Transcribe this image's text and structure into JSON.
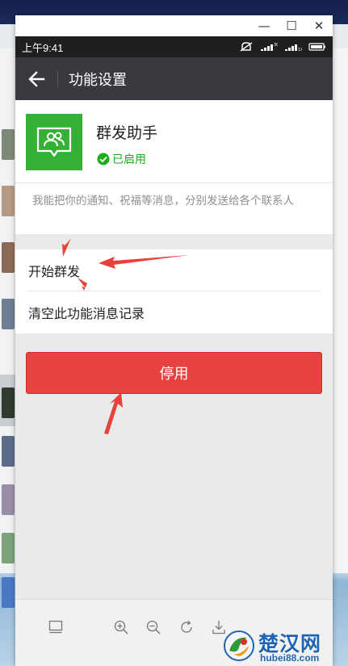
{
  "window": {
    "minimize_glyph": "—",
    "maximize_glyph": "☐",
    "close_glyph": "✕"
  },
  "status_bar": {
    "time": "上午9:41",
    "icons": [
      "no-disturb-icon",
      "signal-3g-icon",
      "signal-1x-icon",
      "battery-icon"
    ]
  },
  "header": {
    "title": "功能设置",
    "back_icon": "arrow-left-icon"
  },
  "feature": {
    "name": "群发助手",
    "status": "已启用",
    "icon": "group-users-icon",
    "description": "我能把你的通知、祝福等消息，分别发送给各个联系人"
  },
  "actions": {
    "start_mass_send": "开始群发",
    "clear_history": "清空此功能消息记录"
  },
  "disable_button": "停用",
  "toolbar": {
    "icons": [
      "screen-icon",
      "zoom-in-icon",
      "zoom-out-icon",
      "rotate-icon",
      "download-icon"
    ]
  },
  "watermark": {
    "name": "楚汉网",
    "url": "hubei88.com"
  },
  "colors": {
    "app_header": "#393a3f",
    "feature_green": "#34b134",
    "enabled_green": "#1aad19",
    "danger_red": "#e64340",
    "annotation_red": "#e8403a"
  }
}
